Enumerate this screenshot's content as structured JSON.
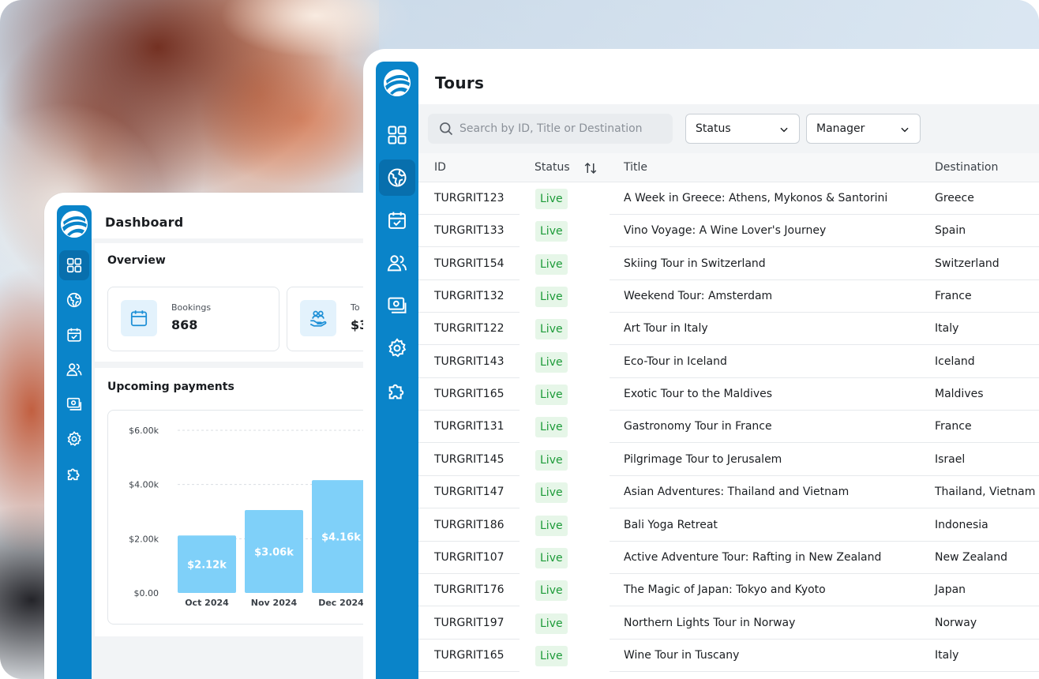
{
  "colors": {
    "brand": "#0a84c9",
    "brand_active": "#086fad",
    "live_text": "#1c9a38",
    "live_bg": "#e6f6e8",
    "bar": "#7fd0f9"
  },
  "rail_icons": [
    "globe-logo",
    "grid-icon",
    "globe-icon",
    "calendar-check-icon",
    "users-icon",
    "money-icon",
    "gear-icon",
    "puzzle-icon"
  ],
  "dashboard": {
    "title": "Dashboard",
    "overview_title": "Overview",
    "stats": [
      {
        "label": "Bookings",
        "value": "868",
        "icon": "calendar-icon"
      },
      {
        "label": "To",
        "value": "$3",
        "icon": "hand-people-icon"
      }
    ],
    "payments_title": "Upcoming payments"
  },
  "chart_data": {
    "type": "bar",
    "title": "Upcoming payments",
    "categories": [
      "Oct 2024",
      "Nov 2024",
      "Dec 2024"
    ],
    "values": [
      2.12,
      3.06,
      4.16
    ],
    "value_labels": [
      "$2.12k",
      "$3.06k",
      "$4.16k"
    ],
    "y_ticks": [
      "$0.00",
      "$2.00k",
      "$4.00k",
      "$6.00k"
    ],
    "y_tick_values": [
      0,
      2,
      4,
      6
    ],
    "ylim": [
      0,
      6
    ],
    "grid": true,
    "xlabel": "",
    "ylabel": ""
  },
  "tours": {
    "title": "Tours",
    "search_placeholder": "Search by ID, Title or Destination",
    "filters": {
      "status": "Status",
      "manager": "Manager"
    },
    "columns": {
      "id": "ID",
      "status": "Status",
      "title": "Title",
      "destination": "Destination"
    },
    "rows": [
      {
        "id": "TURGRIT123",
        "status": "Live",
        "title": "A Week in Greece: Athens, Mykonos & Santorini",
        "destination": "Greece"
      },
      {
        "id": "TURGRIT133",
        "status": "Live",
        "title": "Vino Voyage: A Wine Lover's Journey",
        "destination": "Spain"
      },
      {
        "id": "TURGRIT154",
        "status": "Live",
        "title": "Skiing Tour in Switzerland",
        "destination": "Switzerland"
      },
      {
        "id": "TURGRIT132",
        "status": "Live",
        "title": "Weekend Tour: Amsterdam",
        "destination": "France"
      },
      {
        "id": "TURGRIT122",
        "status": "Live",
        "title": "Art Tour in Italy",
        "destination": "Italy"
      },
      {
        "id": "TURGRIT143",
        "status": "Live",
        "title": "Eco-Tour in Iceland",
        "destination": "Iceland"
      },
      {
        "id": "TURGRIT165",
        "status": "Live",
        "title": "Exotic Tour to the Maldives",
        "destination": "Maldives"
      },
      {
        "id": "TURGRIT131",
        "status": "Live",
        "title": "Gastronomy Tour in France",
        "destination": "France"
      },
      {
        "id": "TURGRIT145",
        "status": "Live",
        "title": "Pilgrimage Tour to Jerusalem",
        "destination": "Israel"
      },
      {
        "id": "TURGRIT147",
        "status": "Live",
        "title": "Asian Adventures: Thailand and Vietnam",
        "destination": "Thailand, Vietnam"
      },
      {
        "id": "TURGRIT186",
        "status": "Live",
        "title": "Bali Yoga Retreat",
        "destination": "Indonesia"
      },
      {
        "id": "TURGRIT107",
        "status": "Live",
        "title": "Active Adventure Tour: Rafting in New Zealand",
        "destination": "New Zealand"
      },
      {
        "id": "TURGRIT176",
        "status": "Live",
        "title": "The Magic of Japan: Tokyo and Kyoto",
        "destination": "Japan"
      },
      {
        "id": "TURGRIT197",
        "status": "Live",
        "title": "Northern Lights Tour in Norway",
        "destination": "Norway"
      },
      {
        "id": "TURGRIT165",
        "status": "Live",
        "title": "Wine Tour in Tuscany",
        "destination": "Italy"
      }
    ]
  }
}
